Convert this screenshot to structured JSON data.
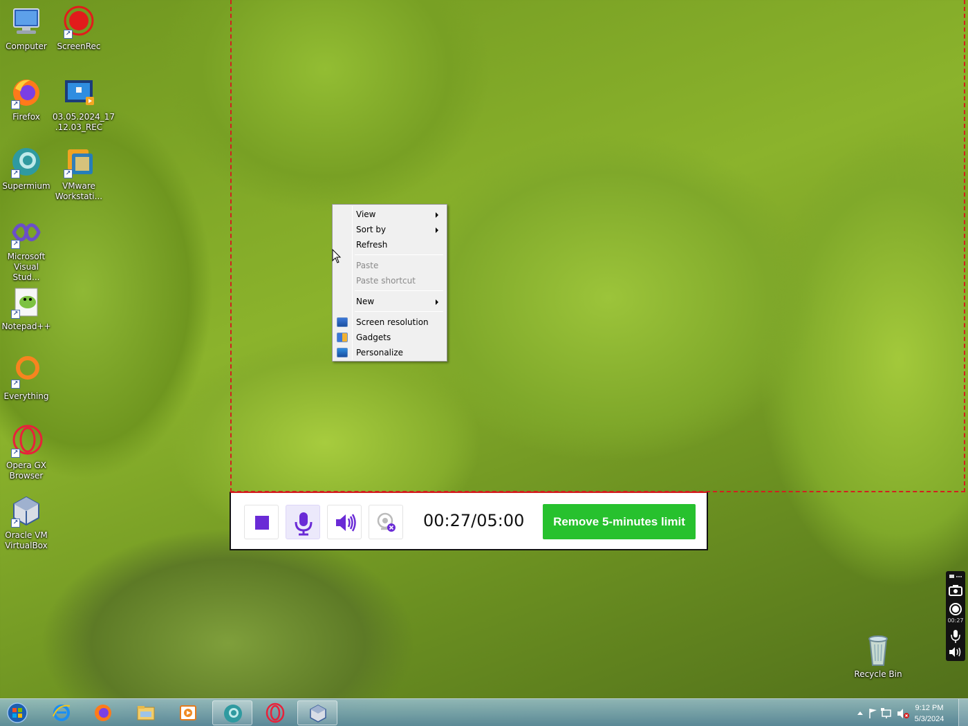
{
  "desktop": {
    "icons": [
      {
        "label": "Computer",
        "icon": "computer-icon"
      },
      {
        "label": "ScreenRec",
        "icon": "screenrec-icon"
      },
      {
        "label": "Firefox",
        "icon": "firefox-icon"
      },
      {
        "label": "03.05.2024_17\n.12.03_REC",
        "icon": "video-file-icon"
      },
      {
        "label": "Supermium",
        "icon": "supermium-icon"
      },
      {
        "label": "VMware\nWorkstati...",
        "icon": "vmware-icon"
      },
      {
        "label": "Microsoft\nVisual Stud...",
        "icon": "visual-studio-icon"
      },
      {
        "label": "Notepad++",
        "icon": "notepadpp-icon"
      },
      {
        "label": "Everything",
        "icon": "everything-icon"
      },
      {
        "label": "Opera GX\nBrowser",
        "icon": "opera-gx-icon"
      },
      {
        "label": "Oracle VM\nVirtualBox",
        "icon": "virtualbox-icon"
      },
      {
        "label": "Recycle Bin",
        "icon": "recycle-bin-icon"
      }
    ]
  },
  "context_menu": {
    "items": [
      {
        "label": "View",
        "submenu": true,
        "enabled": true
      },
      {
        "label": "Sort by",
        "submenu": true,
        "enabled": true
      },
      {
        "label": "Refresh",
        "submenu": false,
        "enabled": true
      },
      {
        "label": "Paste",
        "submenu": false,
        "enabled": false
      },
      {
        "label": "Paste shortcut",
        "submenu": false,
        "enabled": false
      },
      {
        "label": "New",
        "submenu": true,
        "enabled": true
      },
      {
        "label": "Screen resolution",
        "submenu": false,
        "enabled": true,
        "icon": "screen-resolution-icon"
      },
      {
        "label": "Gadgets",
        "submenu": false,
        "enabled": true,
        "icon": "gadgets-icon"
      },
      {
        "label": "Personalize",
        "submenu": false,
        "enabled": true,
        "icon": "personalize-icon"
      }
    ]
  },
  "recorder": {
    "timer": "00:27/05:00",
    "cta_label": "Remove 5-minutes limit",
    "buttons": [
      "stop-icon",
      "microphone-icon",
      "speaker-icon",
      "webcam-off-icon"
    ],
    "accent_color": "#6a2bd6",
    "cta_color": "#27c12e",
    "frame_color": "#d21f1f"
  },
  "side_widget": {
    "time": "00:27"
  },
  "taskbar": {
    "apps": [
      "start-orb-icon",
      "internet-explorer-icon",
      "firefox-icon",
      "file-explorer-icon",
      "media-player-icon",
      "supermium-icon",
      "opera-gx-icon",
      "virtualbox-icon"
    ],
    "clock_time": "9:12 PM",
    "clock_date": "5/3/2024"
  }
}
